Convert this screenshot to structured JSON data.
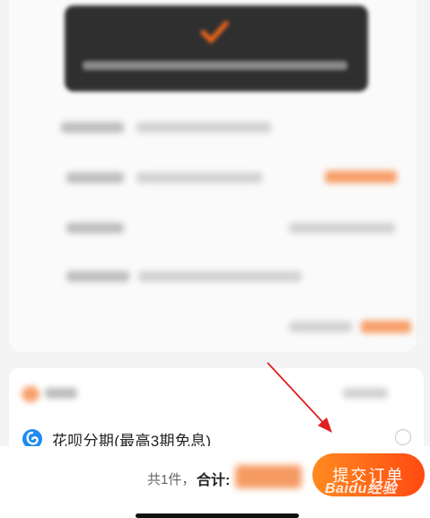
{
  "payment": {
    "huabei_label": "花呗分期(最高3期免息)",
    "selected": false
  },
  "footer": {
    "count_text": "共1件，",
    "total_label": "合计:",
    "submit_label": "提交订单"
  },
  "watermark": "Baidu经验",
  "icons": [
    "huabei-icon",
    "radio-icon",
    "checkmark-icon",
    "arrow-annotation-icon"
  ],
  "colors": {
    "accent_orange": "#ff6a1a",
    "huabei_blue": "#1e8cf0",
    "annotation_red": "#e02020"
  }
}
